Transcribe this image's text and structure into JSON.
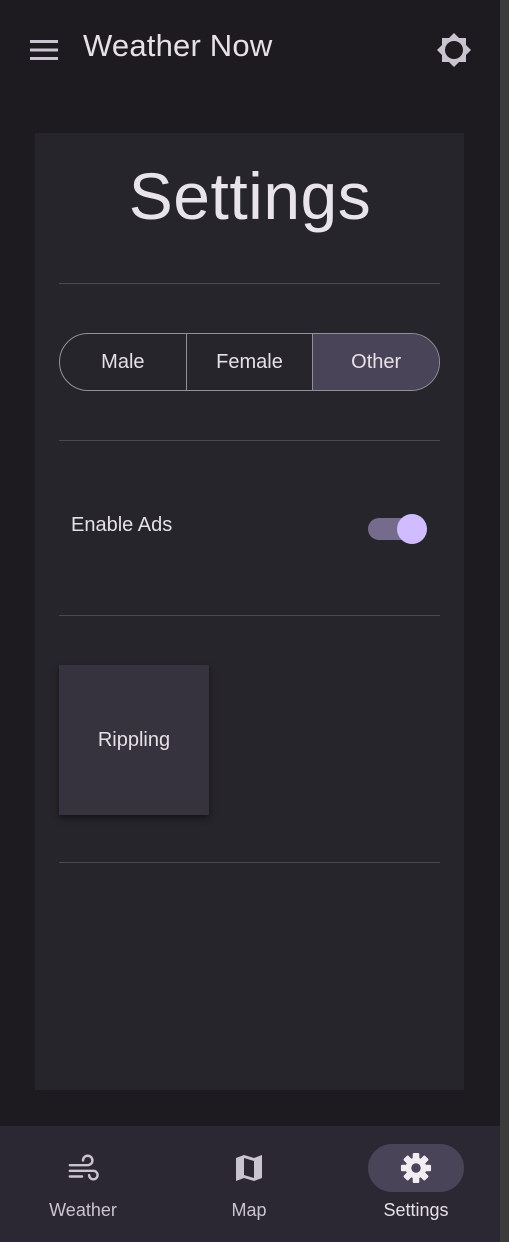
{
  "app_bar": {
    "title": "Weather Now",
    "menu_icon": "menu-icon",
    "action_icon": "brightness-icon"
  },
  "settings": {
    "title": "Settings",
    "gender_options": [
      {
        "label": "Male",
        "selected": false
      },
      {
        "label": "Female",
        "selected": false
      },
      {
        "label": "Other",
        "selected": true
      }
    ],
    "enable_ads": {
      "label": "Enable Ads",
      "on": true
    },
    "ripple_box": {
      "label": "Rippling"
    }
  },
  "bottom_nav": {
    "items": [
      {
        "label": "Weather",
        "icon": "wind-icon",
        "active": false
      },
      {
        "label": "Map",
        "icon": "map-icon",
        "active": false
      },
      {
        "label": "Settings",
        "icon": "gear-icon",
        "active": true
      }
    ]
  },
  "colors": {
    "background": "#1d1b20",
    "surface": "#26252b",
    "primary": "#d0bcff",
    "selected_container": "#4a4458",
    "nav_background": "#2b2833"
  }
}
